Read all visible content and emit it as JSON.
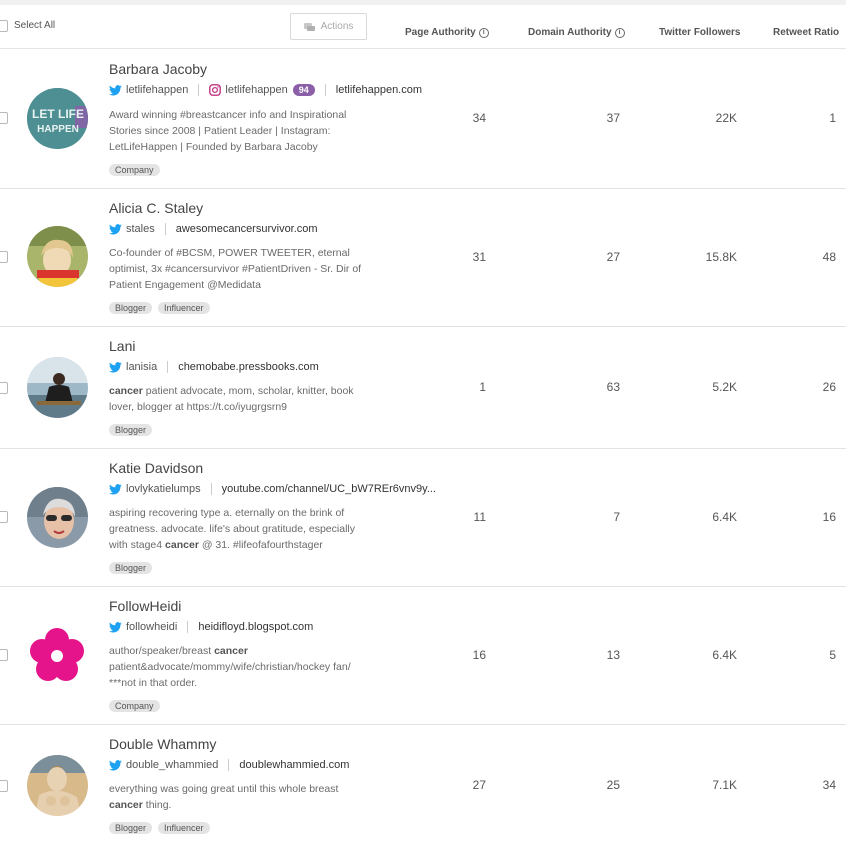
{
  "header": {
    "select_all_label": "Select All",
    "actions_label": "Actions",
    "columns": {
      "page_authority": "Page Authority",
      "domain_authority": "Domain Authority",
      "twitter_followers": "Twitter Followers",
      "retweet_ratio": "Retweet Ratio"
    }
  },
  "rows": [
    {
      "name": "Barbara Jacoby",
      "twitter": "letlifehappen",
      "instagram": "letlifehappen",
      "instagram_badge": "94",
      "site": "letlifehappen.com",
      "bio": "Award winning #breastcancer info and Inspirational Stories since 2008 | Patient Leader | Instagram: LetLifeHappen | Founded by Barbara Jacoby",
      "tags": [
        "Company"
      ],
      "page_authority": "34",
      "domain_authority": "37",
      "twitter_followers": "22K",
      "retweet_ratio": "1",
      "avatar_text_1": "LET LIFE",
      "avatar_text_2": "HAPPEN"
    },
    {
      "name": "Alicia C. Staley",
      "twitter": "stales",
      "site": "awesomecancersurvivor.com",
      "bio": "Co-founder of #BCSM, POWER TWEETER, eternal optimist, 3x #cancersurvivor #PatientDriven - Sr. Dir of Patient Engagement @Medidata",
      "tags": [
        "Blogger",
        "Influencer"
      ],
      "page_authority": "31",
      "domain_authority": "27",
      "twitter_followers": "15.8K",
      "retweet_ratio": "48"
    },
    {
      "name": "Lani",
      "twitter": "lanisia",
      "site": "chemobabe.pressbooks.com",
      "bio_bold": "cancer",
      "bio_rest": " patient advocate, mom, scholar, knitter, book lover, blogger at https://t.co/iyugrgsrn9",
      "tags": [
        "Blogger"
      ],
      "page_authority": "1",
      "domain_authority": "63",
      "twitter_followers": "5.2K",
      "retweet_ratio": "26"
    },
    {
      "name": "Katie Davidson",
      "twitter": "lovlykatielumps",
      "site": "youtube.com/channel/UC_bW7REr6vnv9y...",
      "bio_pre": "aspiring recovering type a. eternally on the brink of greatness. advocate. life's about gratitude, especially with stage4 ",
      "bio_bold": "cancer",
      "bio_post": " @ 31. #lifeofafourthstager",
      "tags": [
        "Blogger"
      ],
      "page_authority": "11",
      "domain_authority": "7",
      "twitter_followers": "6.4K",
      "retweet_ratio": "16"
    },
    {
      "name": "FollowHeidi",
      "twitter": "followheidi",
      "site": "heidifloyd.blogspot.com",
      "bio_pre": "author/speaker/breast ",
      "bio_bold": "cancer",
      "bio_post": " patient&advocate/mommy/wife/christian/hockey fan/ ***not in that order.",
      "tags": [
        "Company"
      ],
      "page_authority": "16",
      "domain_authority": "13",
      "twitter_followers": "6.4K",
      "retweet_ratio": "5"
    },
    {
      "name": "Double Whammy",
      "twitter": "double_whammied",
      "site": "doublewhammied.com",
      "bio_pre": "everything was going great until this whole breast ",
      "bio_bold": "cancer",
      "bio_post": " thing.",
      "tags": [
        "Blogger",
        "Influencer"
      ],
      "page_authority": "27",
      "domain_authority": "25",
      "twitter_followers": "7.1K",
      "retweet_ratio": "34"
    }
  ],
  "colors": {
    "twitter_blue": "#1da1f2",
    "instagram_badge": "#8a5fa8",
    "flower_pink": "#e5148a"
  }
}
